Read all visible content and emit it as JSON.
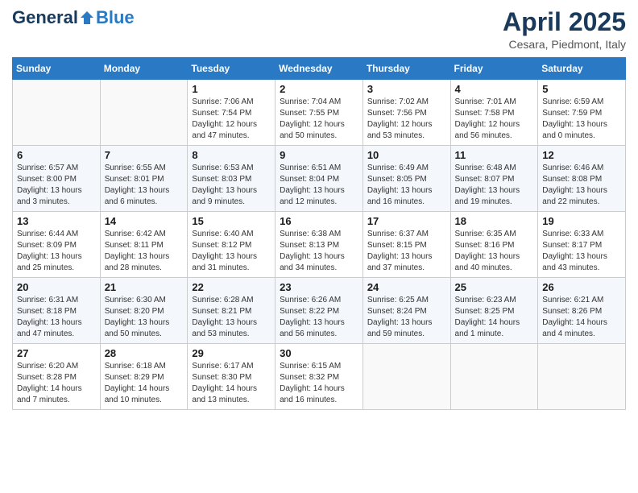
{
  "header": {
    "logo_general": "General",
    "logo_blue": "Blue",
    "title": "April 2025",
    "subtitle": "Cesara, Piedmont, Italy"
  },
  "weekdays": [
    "Sunday",
    "Monday",
    "Tuesday",
    "Wednesday",
    "Thursday",
    "Friday",
    "Saturday"
  ],
  "weeks": [
    [
      {
        "day": "",
        "info": ""
      },
      {
        "day": "",
        "info": ""
      },
      {
        "day": "1",
        "info": "Sunrise: 7:06 AM\nSunset: 7:54 PM\nDaylight: 12 hours and 47 minutes."
      },
      {
        "day": "2",
        "info": "Sunrise: 7:04 AM\nSunset: 7:55 PM\nDaylight: 12 hours and 50 minutes."
      },
      {
        "day": "3",
        "info": "Sunrise: 7:02 AM\nSunset: 7:56 PM\nDaylight: 12 hours and 53 minutes."
      },
      {
        "day": "4",
        "info": "Sunrise: 7:01 AM\nSunset: 7:58 PM\nDaylight: 12 hours and 56 minutes."
      },
      {
        "day": "5",
        "info": "Sunrise: 6:59 AM\nSunset: 7:59 PM\nDaylight: 13 hours and 0 minutes."
      }
    ],
    [
      {
        "day": "6",
        "info": "Sunrise: 6:57 AM\nSunset: 8:00 PM\nDaylight: 13 hours and 3 minutes."
      },
      {
        "day": "7",
        "info": "Sunrise: 6:55 AM\nSunset: 8:01 PM\nDaylight: 13 hours and 6 minutes."
      },
      {
        "day": "8",
        "info": "Sunrise: 6:53 AM\nSunset: 8:03 PM\nDaylight: 13 hours and 9 minutes."
      },
      {
        "day": "9",
        "info": "Sunrise: 6:51 AM\nSunset: 8:04 PM\nDaylight: 13 hours and 12 minutes."
      },
      {
        "day": "10",
        "info": "Sunrise: 6:49 AM\nSunset: 8:05 PM\nDaylight: 13 hours and 16 minutes."
      },
      {
        "day": "11",
        "info": "Sunrise: 6:48 AM\nSunset: 8:07 PM\nDaylight: 13 hours and 19 minutes."
      },
      {
        "day": "12",
        "info": "Sunrise: 6:46 AM\nSunset: 8:08 PM\nDaylight: 13 hours and 22 minutes."
      }
    ],
    [
      {
        "day": "13",
        "info": "Sunrise: 6:44 AM\nSunset: 8:09 PM\nDaylight: 13 hours and 25 minutes."
      },
      {
        "day": "14",
        "info": "Sunrise: 6:42 AM\nSunset: 8:11 PM\nDaylight: 13 hours and 28 minutes."
      },
      {
        "day": "15",
        "info": "Sunrise: 6:40 AM\nSunset: 8:12 PM\nDaylight: 13 hours and 31 minutes."
      },
      {
        "day": "16",
        "info": "Sunrise: 6:38 AM\nSunset: 8:13 PM\nDaylight: 13 hours and 34 minutes."
      },
      {
        "day": "17",
        "info": "Sunrise: 6:37 AM\nSunset: 8:15 PM\nDaylight: 13 hours and 37 minutes."
      },
      {
        "day": "18",
        "info": "Sunrise: 6:35 AM\nSunset: 8:16 PM\nDaylight: 13 hours and 40 minutes."
      },
      {
        "day": "19",
        "info": "Sunrise: 6:33 AM\nSunset: 8:17 PM\nDaylight: 13 hours and 43 minutes."
      }
    ],
    [
      {
        "day": "20",
        "info": "Sunrise: 6:31 AM\nSunset: 8:18 PM\nDaylight: 13 hours and 47 minutes."
      },
      {
        "day": "21",
        "info": "Sunrise: 6:30 AM\nSunset: 8:20 PM\nDaylight: 13 hours and 50 minutes."
      },
      {
        "day": "22",
        "info": "Sunrise: 6:28 AM\nSunset: 8:21 PM\nDaylight: 13 hours and 53 minutes."
      },
      {
        "day": "23",
        "info": "Sunrise: 6:26 AM\nSunset: 8:22 PM\nDaylight: 13 hours and 56 minutes."
      },
      {
        "day": "24",
        "info": "Sunrise: 6:25 AM\nSunset: 8:24 PM\nDaylight: 13 hours and 59 minutes."
      },
      {
        "day": "25",
        "info": "Sunrise: 6:23 AM\nSunset: 8:25 PM\nDaylight: 14 hours and 1 minute."
      },
      {
        "day": "26",
        "info": "Sunrise: 6:21 AM\nSunset: 8:26 PM\nDaylight: 14 hours and 4 minutes."
      }
    ],
    [
      {
        "day": "27",
        "info": "Sunrise: 6:20 AM\nSunset: 8:28 PM\nDaylight: 14 hours and 7 minutes."
      },
      {
        "day": "28",
        "info": "Sunrise: 6:18 AM\nSunset: 8:29 PM\nDaylight: 14 hours and 10 minutes."
      },
      {
        "day": "29",
        "info": "Sunrise: 6:17 AM\nSunset: 8:30 PM\nDaylight: 14 hours and 13 minutes."
      },
      {
        "day": "30",
        "info": "Sunrise: 6:15 AM\nSunset: 8:32 PM\nDaylight: 14 hours and 16 minutes."
      },
      {
        "day": "",
        "info": ""
      },
      {
        "day": "",
        "info": ""
      },
      {
        "day": "",
        "info": ""
      }
    ]
  ]
}
